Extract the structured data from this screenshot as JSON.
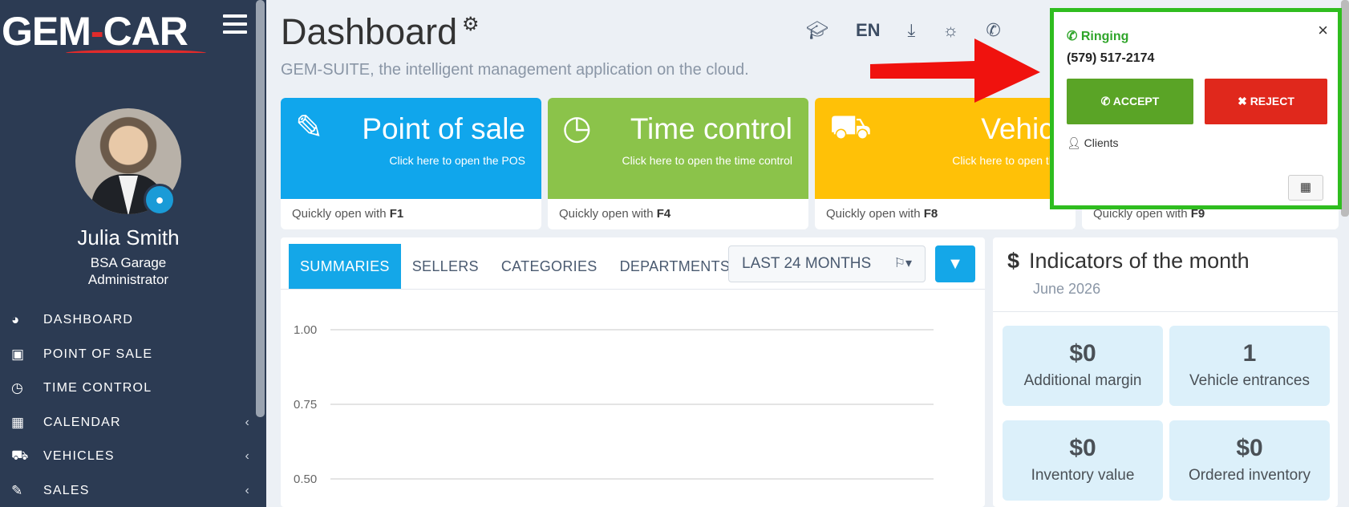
{
  "brand": {
    "logo_left": "GEM",
    "logo_dash": "-",
    "logo_right": "CAR"
  },
  "user": {
    "name": "Julia Smith",
    "organization": "BSA Garage",
    "role": "Administrator"
  },
  "menu": [
    {
      "label": "DASHBOARD",
      "icon": "dashboard-icon",
      "glyph": "◕",
      "chevron": ""
    },
    {
      "label": "POINT OF SALE",
      "icon": "money-icon",
      "glyph": "▣",
      "chevron": ""
    },
    {
      "label": "TIME CONTROL",
      "icon": "clock-icon",
      "glyph": "◷",
      "chevron": ""
    },
    {
      "label": "CALENDAR",
      "icon": "calendar-icon",
      "glyph": "▦",
      "chevron": "‹"
    },
    {
      "label": "VEHICLES",
      "icon": "car-icon",
      "glyph": "⛟",
      "chevron": "‹"
    },
    {
      "label": "SALES",
      "icon": "edit-icon",
      "glyph": "✎",
      "chevron": "‹"
    }
  ],
  "header": {
    "title": "Dashboard",
    "subtitle": "GEM-SUITE, the intelligent management application on the cloud.",
    "language": "EN"
  },
  "tiles": [
    {
      "title": "Point of sale",
      "subtitle": "Click here to open the POS",
      "shortcut_text": "Quickly open with ",
      "shortcut_key": "F1",
      "color": "#10a6ec"
    },
    {
      "title": "Time control",
      "subtitle": "Click here to open the time control",
      "shortcut_text": "Quickly open with ",
      "shortcut_key": "F4",
      "color": "#8bc34a"
    },
    {
      "title": "Vehicles",
      "subtitle": "Click here to open the calendar",
      "shortcut_text": "Quickly open with ",
      "shortcut_key": "F8",
      "color": "#ffc107"
    },
    {
      "title": "",
      "subtitle": "",
      "shortcut_text": "Quickly open with ",
      "shortcut_key": "F9",
      "color": "#ffffff"
    }
  ],
  "chart_panel": {
    "tabs": [
      "SUMMARIES",
      "SELLERS",
      "CATEGORIES",
      "DEPARTMENTS"
    ],
    "period": "LAST 24 MONTHS"
  },
  "chart_data": {
    "type": "line",
    "y_ticks": [
      "1.00",
      "0.75",
      "0.50"
    ],
    "series": []
  },
  "indicators": {
    "title": "Indicators of the month",
    "date": "June 2026",
    "cards": [
      {
        "value": "$0",
        "label": "Additional margin"
      },
      {
        "value": "1",
        "label": "Vehicle entrances"
      },
      {
        "value": "$0",
        "label": "Inventory value"
      },
      {
        "value": "$0",
        "label": "Ordered inventory"
      }
    ]
  },
  "call": {
    "status": "Ringing",
    "number": "(579) 517-2174",
    "accept_label": "ACCEPT",
    "reject_label": "REJECT",
    "clients_label": "Clients",
    "close_glyph": "×"
  },
  "colors": {
    "sidebar": "#2c3b53",
    "accent": "#14a7e8",
    "highlight_border": "#2fbd1f",
    "arrow": "#f0120e"
  }
}
